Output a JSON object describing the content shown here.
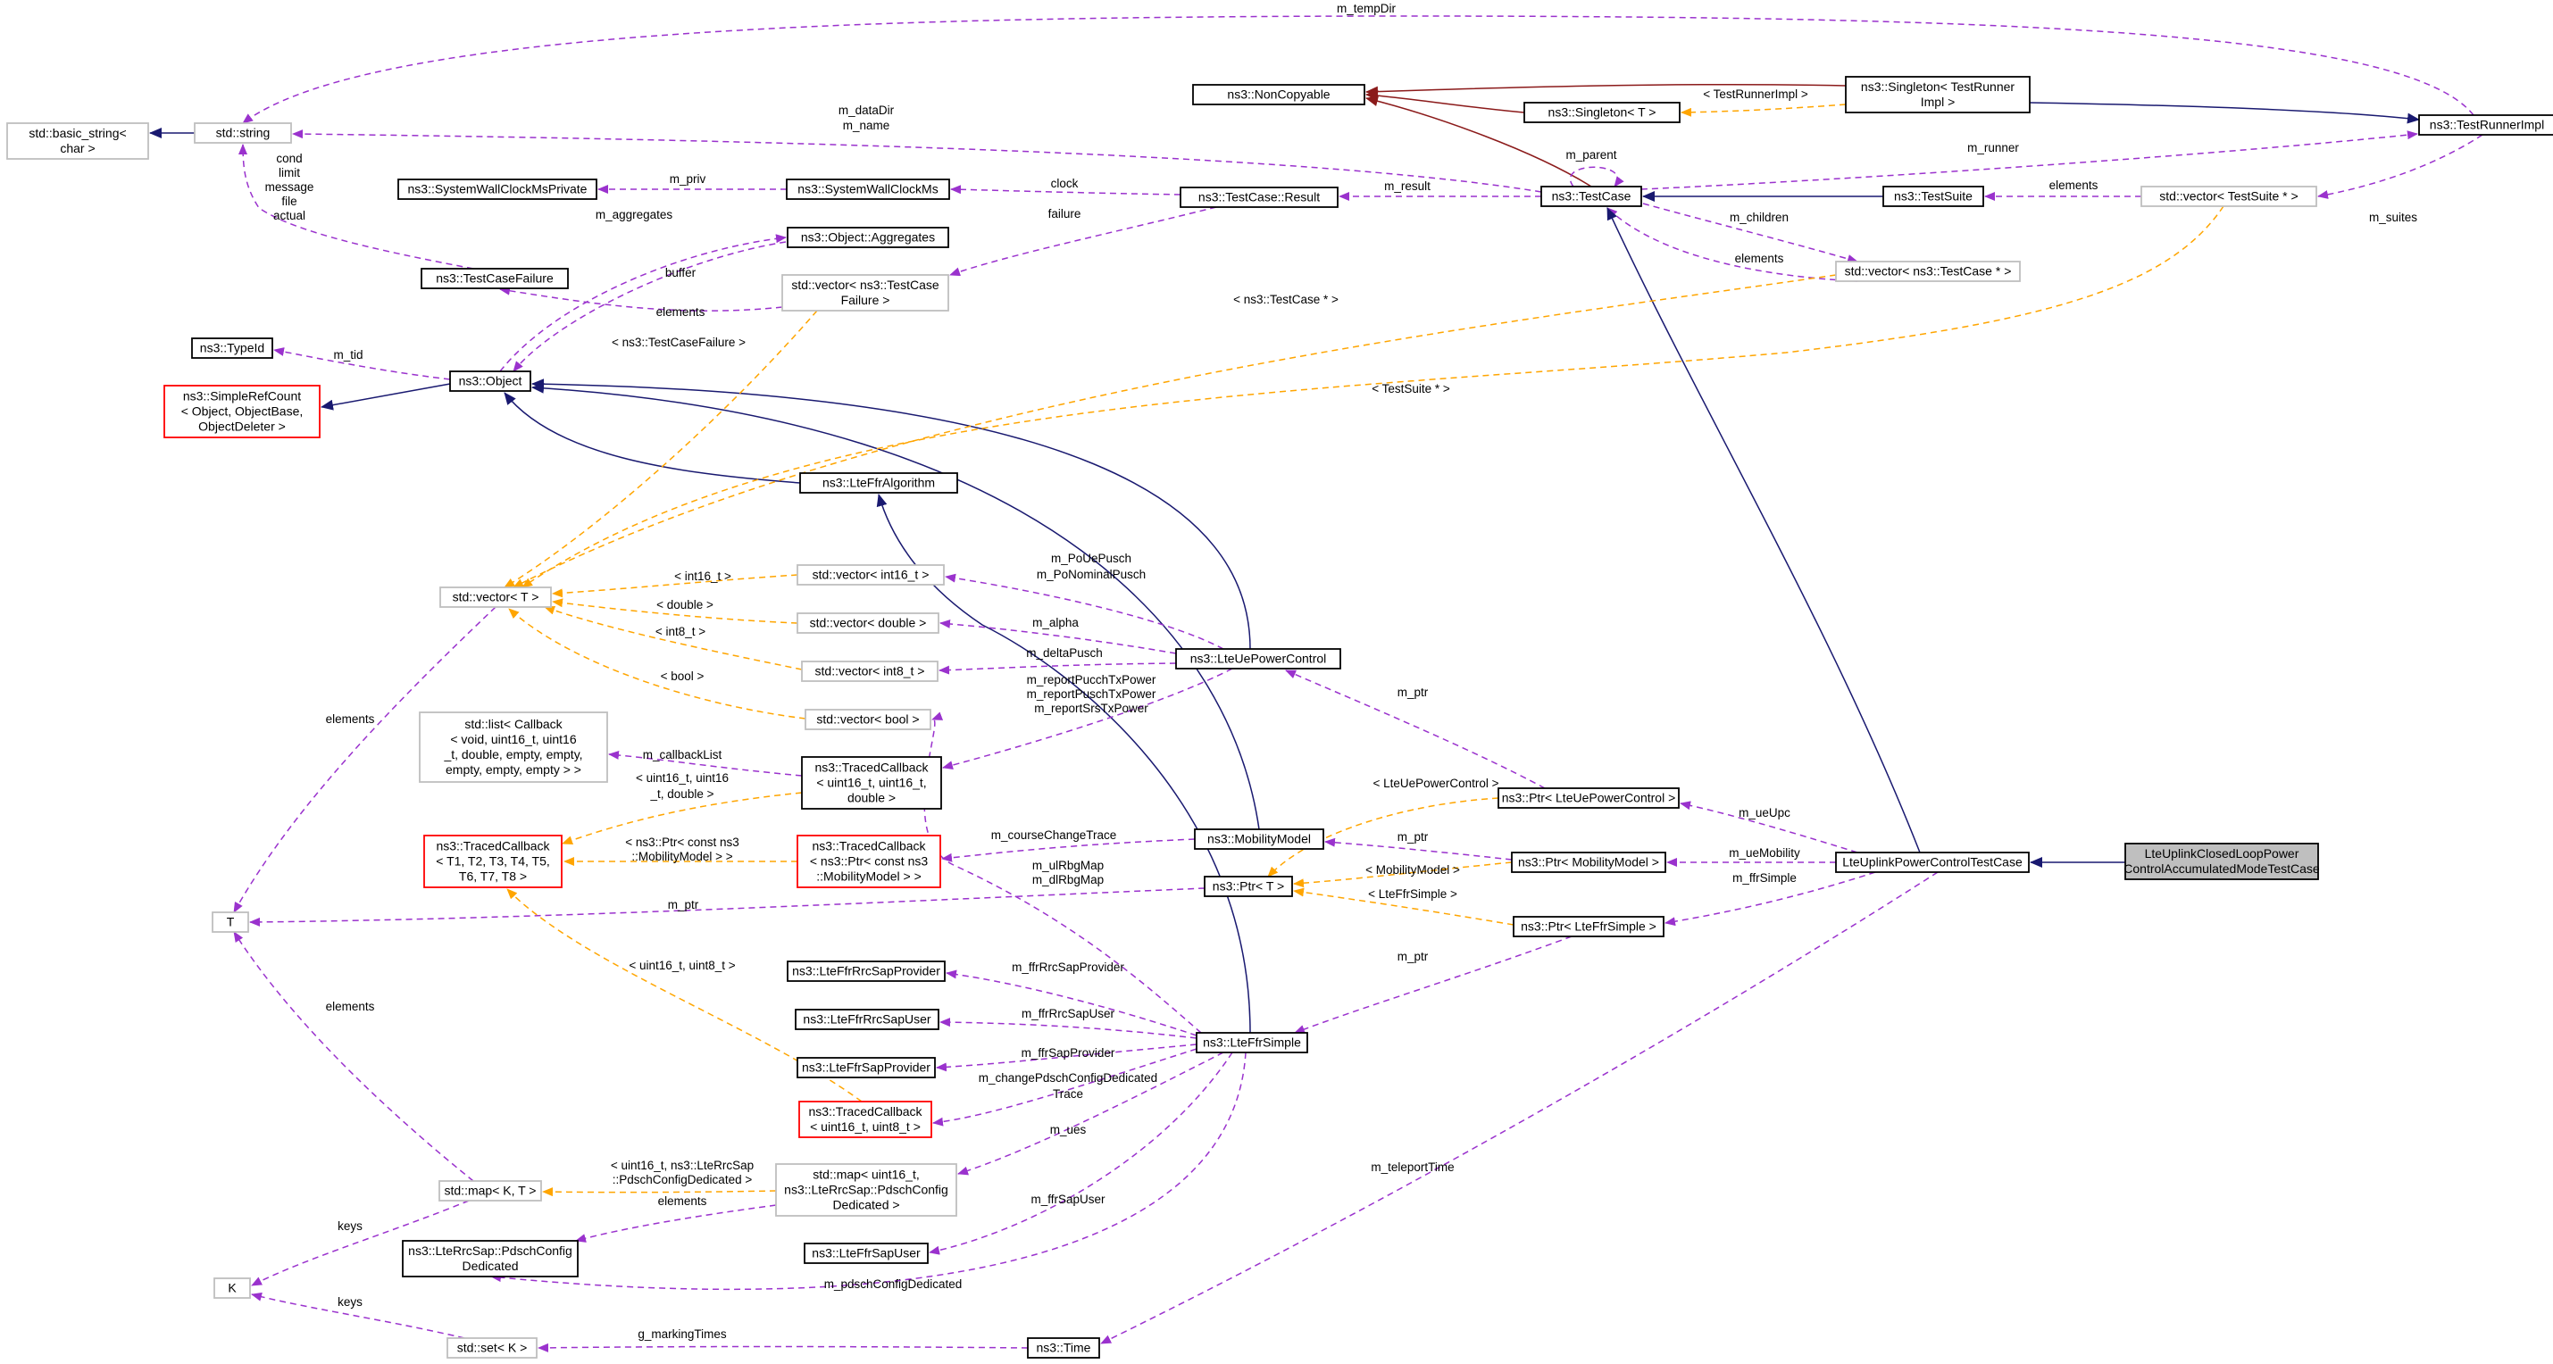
{
  "colors": {
    "composition": "#9a32cd",
    "template": "#ffa500",
    "inheritance": "#191970",
    "private_inheritance": "#8b1a1a",
    "focus_fill": "#bfbfbf",
    "missing_border": "#ff0000",
    "undocumented_border": "#bfbfbf"
  },
  "nodes": [
    {
      "id": "n_basic_string",
      "lines": [
        "std::basic_string<",
        "char >"
      ],
      "style": "grey"
    },
    {
      "id": "n_string",
      "lines": [
        "std::string"
      ],
      "style": "grey"
    },
    {
      "id": "n_noncopyable",
      "lines": [
        "ns3::NonCopyable"
      ],
      "style": "solid"
    },
    {
      "id": "n_singleton_t",
      "lines": [
        "ns3::Singleton< T >"
      ],
      "style": "solid"
    },
    {
      "id": "n_singleton_tri",
      "lines": [
        "ns3::Singleton< TestRunner",
        "Impl >"
      ],
      "style": "solid"
    },
    {
      "id": "n_testrunnerimpl",
      "lines": [
        "ns3::TestRunnerImpl"
      ],
      "style": "solid"
    },
    {
      "id": "n_syswallpriv",
      "lines": [
        "ns3::SystemWallClockMsPrivate"
      ],
      "style": "solid"
    },
    {
      "id": "n_syswall",
      "lines": [
        "ns3::SystemWallClockMs"
      ],
      "style": "solid"
    },
    {
      "id": "n_tcresult",
      "lines": [
        "ns3::TestCase::Result"
      ],
      "style": "solid"
    },
    {
      "id": "n_testcase",
      "lines": [
        "ns3::TestCase"
      ],
      "style": "solid"
    },
    {
      "id": "n_testsuite",
      "lines": [
        "ns3::TestSuite"
      ],
      "style": "solid"
    },
    {
      "id": "n_vec_testsuite",
      "lines": [
        "std::vector< TestSuite * >"
      ],
      "style": "grey"
    },
    {
      "id": "n_vec_testcase",
      "lines": [
        "std::vector< ns3::TestCase * >"
      ],
      "style": "grey"
    },
    {
      "id": "n_aggregates",
      "lines": [
        "ns3::Object::Aggregates"
      ],
      "style": "solid"
    },
    {
      "id": "n_tcfailure",
      "lines": [
        "ns3::TestCaseFailure"
      ],
      "style": "solid"
    },
    {
      "id": "n_vec_tcfailure",
      "lines": [
        "std::vector< ns3::TestCase",
        "Failure >"
      ],
      "style": "grey"
    },
    {
      "id": "n_typeid",
      "lines": [
        "ns3::TypeId"
      ],
      "style": "solid"
    },
    {
      "id": "n_object",
      "lines": [
        "ns3::Object"
      ],
      "style": "solid"
    },
    {
      "id": "n_simplerefcount",
      "lines": [
        "ns3::SimpleRefCount",
        "< Object, ObjectBase,",
        "ObjectDeleter >"
      ],
      "style": "red"
    },
    {
      "id": "n_lteffralgo",
      "lines": [
        "ns3::LteFfrAlgorithm"
      ],
      "style": "solid"
    },
    {
      "id": "n_vec_t",
      "lines": [
        "std::vector< T >"
      ],
      "style": "grey"
    },
    {
      "id": "n_vec_int16",
      "lines": [
        "std::vector< int16_t >"
      ],
      "style": "grey"
    },
    {
      "id": "n_vec_double",
      "lines": [
        "std::vector< double >"
      ],
      "style": "grey"
    },
    {
      "id": "n_vec_int8",
      "lines": [
        "std::vector< int8_t >"
      ],
      "style": "grey"
    },
    {
      "id": "n_vec_bool",
      "lines": [
        "std::vector< bool >"
      ],
      "style": "grey"
    },
    {
      "id": "n_lteuepc",
      "lines": [
        "ns3::LteUePowerControl"
      ],
      "style": "solid"
    },
    {
      "id": "n_list_callback",
      "lines": [
        "std::list< Callback",
        "< void, uint16_t, uint16",
        "_t, double, empty, empty,",
        "empty, empty, empty > >"
      ],
      "style": "grey"
    },
    {
      "id": "n_tc_u16u16d",
      "lines": [
        "ns3::TracedCallback",
        "< uint16_t, uint16_t,",
        "double >"
      ],
      "style": "solid"
    },
    {
      "id": "n_tc_t1t8",
      "lines": [
        "ns3::TracedCallback",
        "< T1, T2, T3, T4, T5,",
        "T6, T7, T8 >"
      ],
      "style": "red"
    },
    {
      "id": "n_tc_mobility",
      "lines": [
        "ns3::TracedCallback",
        "< ns3::Ptr< const ns3",
        "::MobilityModel > >"
      ],
      "style": "red"
    },
    {
      "id": "n_mobility",
      "lines": [
        "ns3::MobilityModel"
      ],
      "style": "solid"
    },
    {
      "id": "n_ptr_uepc",
      "lines": [
        "ns3::Ptr< LteUePowerControl >"
      ],
      "style": "solid"
    },
    {
      "id": "n_ptr_mobility",
      "lines": [
        "ns3::Ptr< MobilityModel >"
      ],
      "style": "solid"
    },
    {
      "id": "n_ptr_t",
      "lines": [
        "ns3::Ptr< T >"
      ],
      "style": "solid"
    },
    {
      "id": "n_ptr_ffrsimple",
      "lines": [
        "ns3::Ptr< LteFfrSimple >"
      ],
      "style": "solid"
    },
    {
      "id": "n_uplinktc",
      "lines": [
        "LteUplinkPowerControlTestCase"
      ],
      "style": "solid"
    },
    {
      "id": "n_focus",
      "lines": [
        "LteUplinkClosedLoopPower",
        "ControlAccumulatedModeTestCase"
      ],
      "style": "filled"
    },
    {
      "id": "n_T",
      "lines": [
        "T"
      ],
      "style": "grey"
    },
    {
      "id": "n_ffrrrcsapprov",
      "lines": [
        "ns3::LteFfrRrcSapProvider"
      ],
      "style": "solid"
    },
    {
      "id": "n_ffrrrcsapuser",
      "lines": [
        "ns3::LteFfrRrcSapUser"
      ],
      "style": "solid"
    },
    {
      "id": "n_ffrsapprov",
      "lines": [
        "ns3::LteFfrSapProvider"
      ],
      "style": "solid"
    },
    {
      "id": "n_tc_u16u8",
      "lines": [
        "ns3::TracedCallback",
        "< uint16_t, uint8_t >"
      ],
      "style": "red"
    },
    {
      "id": "n_ffrsimple",
      "lines": [
        "ns3::LteFfrSimple"
      ],
      "style": "solid"
    },
    {
      "id": "n_map_kt",
      "lines": [
        "std::map< K, T >"
      ],
      "style": "grey"
    },
    {
      "id": "n_map_pdsch",
      "lines": [
        "std::map< uint16_t,",
        "ns3::LteRrcSap::PdschConfig",
        "Dedicated >"
      ],
      "style": "grey"
    },
    {
      "id": "n_K",
      "lines": [
        "K"
      ],
      "style": "grey"
    },
    {
      "id": "n_pdschcfg",
      "lines": [
        "ns3::LteRrcSap::PdschConfig",
        "Dedicated"
      ],
      "style": "solid"
    },
    {
      "id": "n_ffrsapuser",
      "lines": [
        "ns3::LteFfrSapUser"
      ],
      "style": "solid"
    },
    {
      "id": "n_set_k",
      "lines": [
        "std::set< K >"
      ],
      "style": "grey"
    },
    {
      "id": "n_time",
      "lines": [
        "ns3::Time"
      ],
      "style": "solid"
    }
  ],
  "edges": [
    {
      "id": "e_string_basic",
      "kind": "inheritance",
      "lines": []
    },
    {
      "id": "e_nc_singleton_t",
      "kind": "private_inheritance",
      "lines": []
    },
    {
      "id": "e_nc_singleton_tri",
      "kind": "private_inheritance",
      "lines": []
    },
    {
      "id": "e_nc_testcase",
      "kind": "private_inheritance",
      "lines": []
    },
    {
      "id": "e_singleton_tmpl",
      "kind": "template",
      "lines": [
        "< TestRunnerImpl >"
      ]
    },
    {
      "id": "e_singleton_runner",
      "kind": "inheritance",
      "lines": []
    },
    {
      "id": "e_tempdir",
      "kind": "composition",
      "lines": [
        "m_tempDir"
      ]
    },
    {
      "id": "e_datadir",
      "kind": "composition",
      "lines": [
        "m_dataDir",
        "m_name"
      ]
    },
    {
      "id": "e_tcfail_strings",
      "kind": "composition",
      "lines": [
        "cond",
        "limit",
        "message",
        "file",
        "actual"
      ]
    },
    {
      "id": "e_priv",
      "kind": "composition",
      "lines": [
        "m_priv"
      ]
    },
    {
      "id": "e_clock",
      "kind": "composition",
      "lines": [
        "clock"
      ]
    },
    {
      "id": "e_result",
      "kind": "composition",
      "lines": [
        "m_result"
      ]
    },
    {
      "id": "e_parent",
      "kind": "composition",
      "lines": [
        "m_parent"
      ]
    },
    {
      "id": "e_runner",
      "kind": "composition",
      "lines": [
        "m_runner"
      ]
    },
    {
      "id": "e_testsuite_tc",
      "kind": "inheritance",
      "lines": []
    },
    {
      "id": "e_vec_suite_elems",
      "kind": "composition",
      "lines": [
        "elements"
      ]
    },
    {
      "id": "e_suites",
      "kind": "composition",
      "lines": [
        "m_suites"
      ]
    },
    {
      "id": "e_children",
      "kind": "composition",
      "lines": [
        "m_children"
      ]
    },
    {
      "id": "e_vec_tc_elems",
      "kind": "composition",
      "lines": [
        "elements"
      ]
    },
    {
      "id": "e_failure",
      "kind": "composition",
      "lines": [
        "failure"
      ]
    },
    {
      "id": "e_aggregates",
      "kind": "composition",
      "lines": [
        "m_aggregates"
      ]
    },
    {
      "id": "e_buffer",
      "kind": "composition",
      "lines": [
        "buffer"
      ]
    },
    {
      "id": "e_vec_fail_elems",
      "kind": "composition",
      "lines": [
        "elements"
      ]
    },
    {
      "id": "e_tid",
      "kind": "composition",
      "lines": [
        "m_tid"
      ]
    },
    {
      "id": "e_object_refcount",
      "kind": "inheritance",
      "lines": []
    },
    {
      "id": "e_ffralgo_object",
      "kind": "inheritance",
      "lines": []
    },
    {
      "id": "e_uepc_object",
      "kind": "inheritance",
      "lines": []
    },
    {
      "id": "e_mobility_object",
      "kind": "inheritance",
      "lines": []
    },
    {
      "id": "e_ffrsimple_algo",
      "kind": "inheritance",
      "lines": []
    },
    {
      "id": "e_uplinktc_tc",
      "kind": "inheritance",
      "lines": []
    },
    {
      "id": "e_focus_uplinktc",
      "kind": "inheritance",
      "lines": []
    },
    {
      "id": "e_tmpl_tc",
      "kind": "template",
      "lines": [
        "< ns3::TestCase * >"
      ]
    },
    {
      "id": "e_tmpl_ts",
      "kind": "template",
      "lines": [
        "< TestSuite * >"
      ]
    },
    {
      "id": "e_tmpl_tcf",
      "kind": "template",
      "lines": [
        "< ns3::TestCaseFailure >"
      ]
    },
    {
      "id": "e_tmpl_int16",
      "kind": "template",
      "lines": [
        "< int16_t >"
      ]
    },
    {
      "id": "e_tmpl_double",
      "kind": "template",
      "lines": [
        "< double >"
      ]
    },
    {
      "id": "e_tmpl_int8",
      "kind": "template",
      "lines": [
        "< int8_t >"
      ]
    },
    {
      "id": "e_tmpl_bool",
      "kind": "template",
      "lines": [
        "< bool >"
      ]
    },
    {
      "id": "e_pousch",
      "kind": "composition",
      "lines": [
        "m_PoUePusch",
        "m_PoNominalPusch"
      ]
    },
    {
      "id": "e_alpha",
      "kind": "composition",
      "lines": [
        "m_alpha"
      ]
    },
    {
      "id": "e_deltapusch",
      "kind": "composition",
      "lines": [
        "m_deltaPusch"
      ]
    },
    {
      "id": "e_report",
      "kind": "composition",
      "lines": [
        "m_reportPucchTxPower",
        "m_reportPuschTxPower",
        "m_reportSrsTxPower"
      ]
    },
    {
      "id": "e_callbacklist",
      "kind": "composition",
      "lines": [
        "m_callbackList"
      ]
    },
    {
      "id": "e_tmpl_u16u16d",
      "kind": "template",
      "lines": [
        "< uint16_t, uint16",
        "_t, double >"
      ]
    },
    {
      "id": "e_tmpl_mob",
      "kind": "template",
      "lines": [
        "< ns3::Ptr< const ns3",
        "::MobilityModel > >"
      ]
    },
    {
      "id": "e_coursechange",
      "kind": "composition",
      "lines": [
        "m_courseChangeTrace"
      ]
    },
    {
      "id": "e_ptr_uepc",
      "kind": "composition",
      "lines": [
        "m_ptr"
      ]
    },
    {
      "id": "e_ptr_mob",
      "kind": "composition",
      "lines": [
        "m_ptr"
      ]
    },
    {
      "id": "e_tmpl_ptr_uepc",
      "kind": "template",
      "lines": [
        "< LteUePowerControl >"
      ]
    },
    {
      "id": "e_tmpl_ptr_mob",
      "kind": "template",
      "lines": [
        "< MobilityModel >"
      ]
    },
    {
      "id": "e_tmpl_ptr_ffr",
      "kind": "template",
      "lines": [
        "< LteFfrSimple >"
      ]
    },
    {
      "id": "e_ueupc",
      "kind": "composition",
      "lines": [
        "m_ueUpc"
      ]
    },
    {
      "id": "e_uemobility",
      "kind": "composition",
      "lines": [
        "m_ueMobility"
      ]
    },
    {
      "id": "e_ffrsimple",
      "kind": "composition",
      "lines": [
        "m_ffrSimple"
      ]
    },
    {
      "id": "e_ptr_t_T",
      "kind": "composition",
      "lines": [
        "m_ptr"
      ]
    },
    {
      "id": "e_rbgmap",
      "kind": "composition",
      "lines": [
        "m_ulRbgMap",
        "m_dlRbgMap"
      ]
    },
    {
      "id": "e_ptr_ffr",
      "kind": "composition",
      "lines": [
        "m_ptr"
      ]
    },
    {
      "id": "e_vec_t_T",
      "kind": "composition",
      "lines": [
        "elements"
      ]
    },
    {
      "id": "e_ffrrrcsapprov",
      "kind": "composition",
      "lines": [
        "m_ffrRrcSapProvider"
      ]
    },
    {
      "id": "e_ffrrrcsapuser",
      "kind": "composition",
      "lines": [
        "m_ffrRrcSapUser"
      ]
    },
    {
      "id": "e_ffrsapprov",
      "kind": "composition",
      "lines": [
        "m_ffrSapProvider"
      ]
    },
    {
      "id": "e_changepdsch",
      "kind": "composition",
      "lines": [
        "m_changePdschConfigDedicated",
        "Trace"
      ]
    },
    {
      "id": "e_tmpl_u16u8",
      "kind": "template",
      "lines": [
        "< uint16_t, uint8_t >"
      ]
    },
    {
      "id": "e_ues",
      "kind": "composition",
      "lines": [
        "m_ues"
      ]
    },
    {
      "id": "e_ffrsapuser",
      "kind": "composition",
      "lines": [
        "m_ffrSapUser"
      ]
    },
    {
      "id": "e_pdschcfg",
      "kind": "composition",
      "lines": [
        "m_pdschConfigDedicated"
      ]
    },
    {
      "id": "e_map_T",
      "kind": "composition",
      "lines": [
        "elements"
      ]
    },
    {
      "id": "e_tmpl_map",
      "kind": "template",
      "lines": [
        "< uint16_t, ns3::LteRrcSap",
        "::PdschConfigDedicated >"
      ]
    },
    {
      "id": "e_map_elems",
      "kind": "composition",
      "lines": [
        "elements"
      ]
    },
    {
      "id": "e_map_keys",
      "kind": "composition",
      "lines": [
        "keys"
      ]
    },
    {
      "id": "e_set_keys",
      "kind": "composition",
      "lines": [
        "keys"
      ]
    },
    {
      "id": "e_markingtimes",
      "kind": "composition",
      "lines": [
        "g_markingTimes"
      ]
    },
    {
      "id": "e_teleport",
      "kind": "composition",
      "lines": [
        "m_teleportTime"
      ]
    }
  ]
}
